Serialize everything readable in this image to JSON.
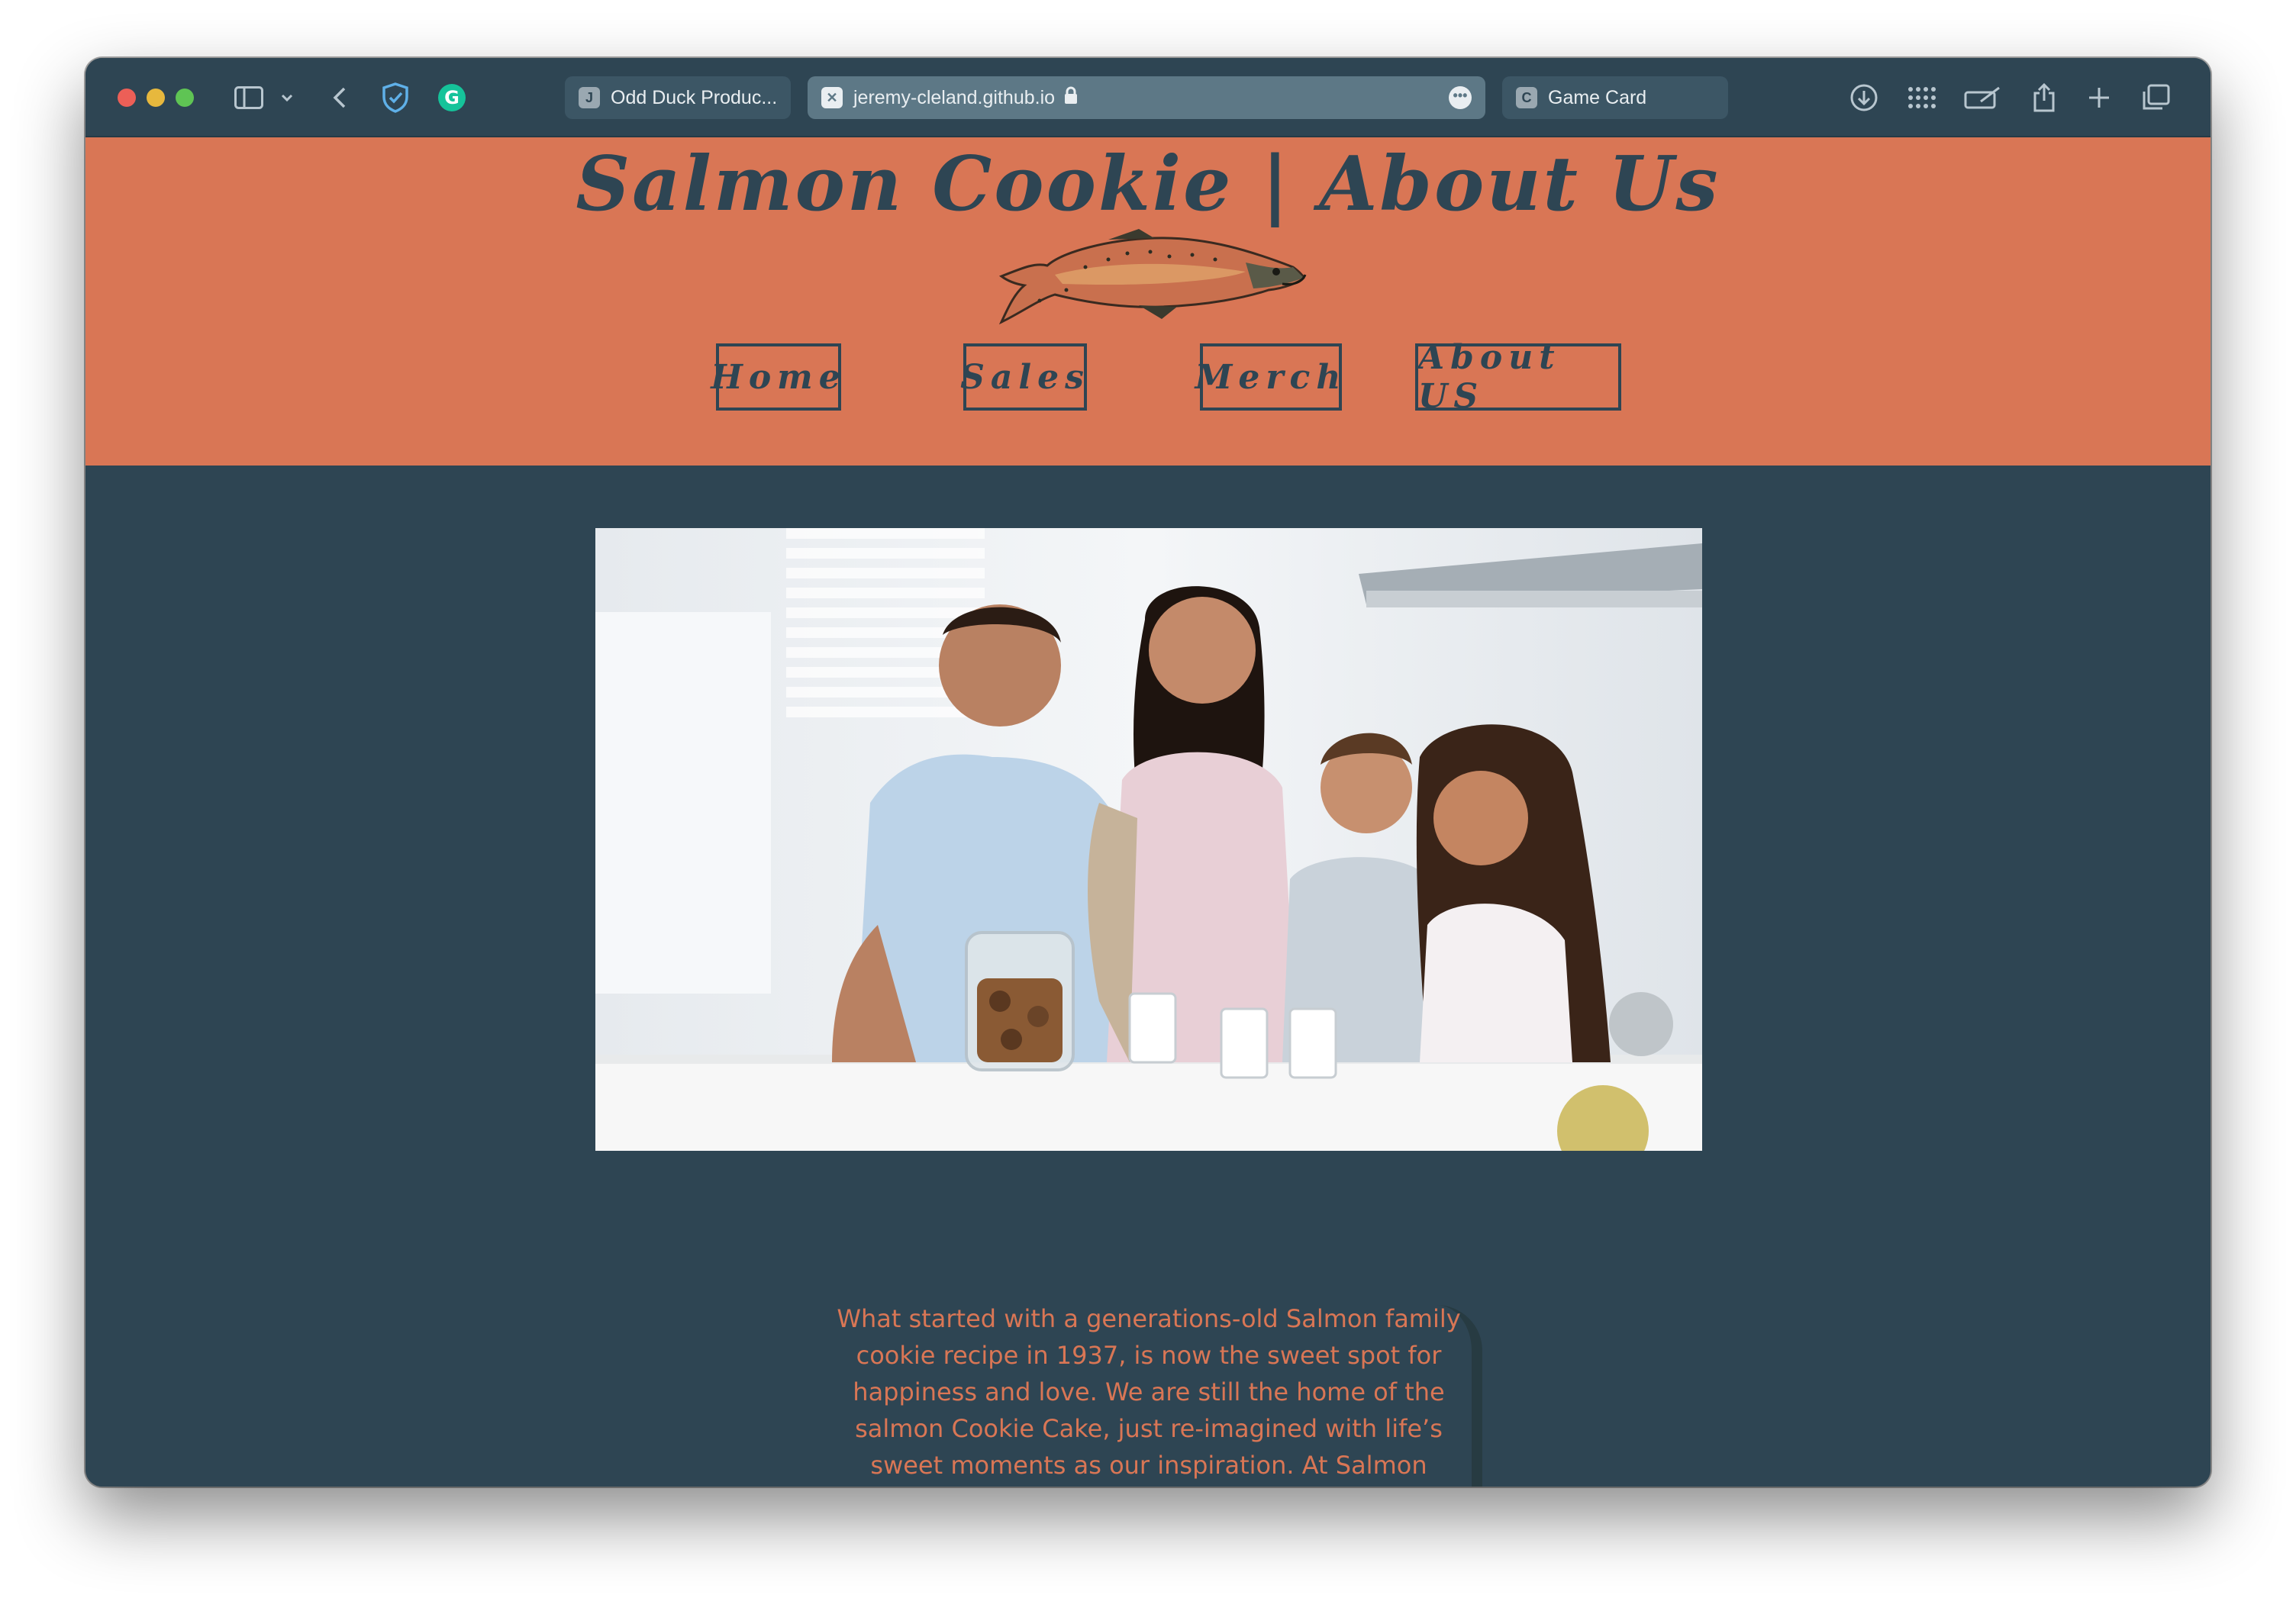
{
  "browser": {
    "tabs": [
      {
        "label": "Odd Duck Produc...",
        "favicon": "J",
        "active": false
      },
      {
        "label": "jeremy-cleland.github.io",
        "favicon": "x-icon",
        "active": true
      },
      {
        "label": "Game Card",
        "favicon": "C",
        "active": false
      }
    ],
    "more_label": "•••"
  },
  "site": {
    "title": "Salmon Cookie | About Us",
    "nav": [
      "Home",
      "Sales",
      "Merch",
      "About US"
    ],
    "about_text": "What started with a generations-old Salmon family cookie recipe in 1937, is now the sweet spot for happiness and love. We are still the home of the salmon Cookie Cake, just re-imagined with life’s sweet moments as our inspiration. At Salmon Cookies, we believe that pure, simple delight is part of living a full life."
  },
  "colors": {
    "header_bg": "#d97655",
    "page_bg": "#2e4553",
    "accent_text": "#d97655"
  }
}
